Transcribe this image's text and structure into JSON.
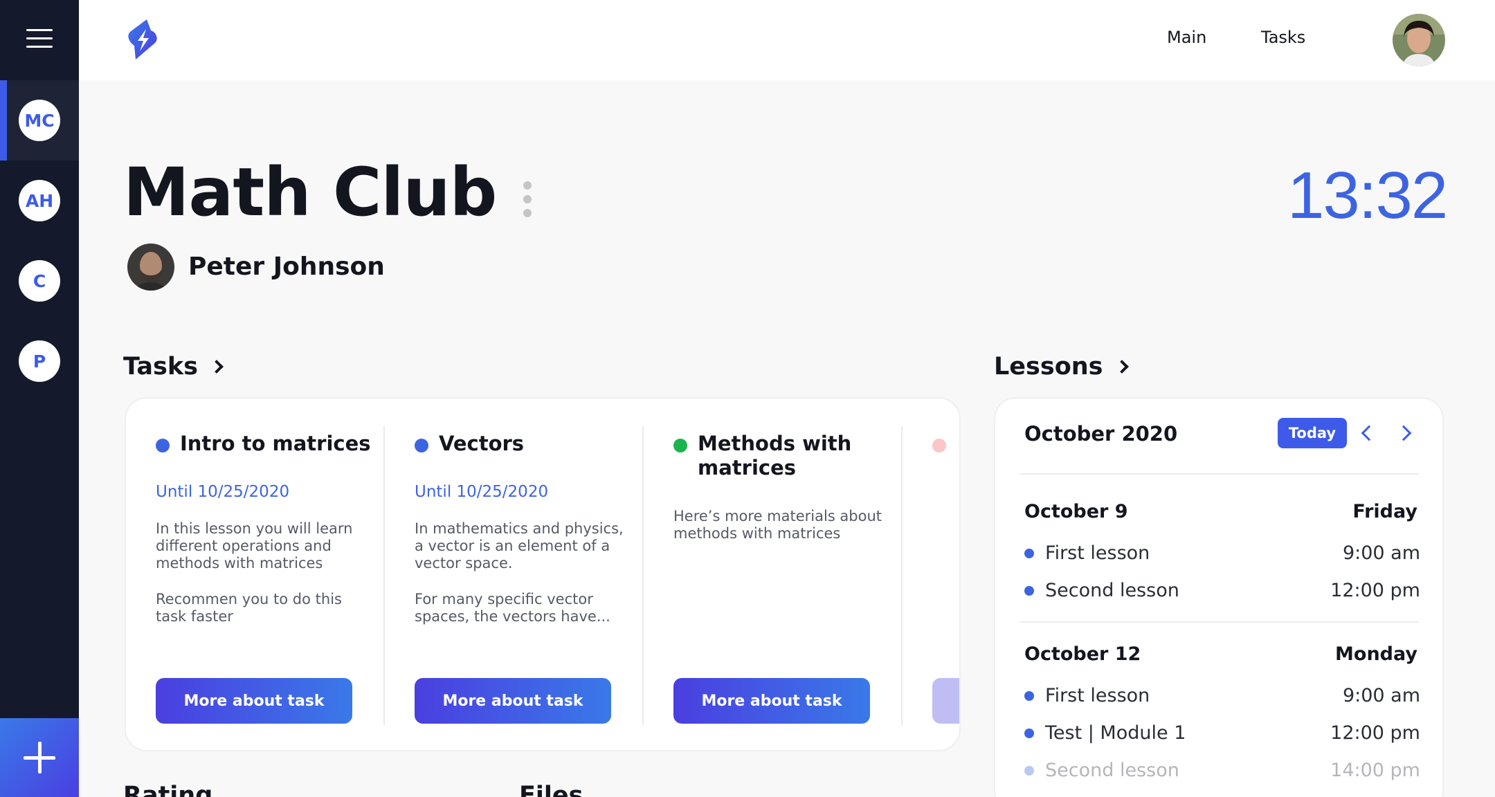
{
  "topbar": {
    "logo_icon": "lightning-bolt-icon",
    "nav": {
      "main": "Main",
      "tasks": "Tasks"
    }
  },
  "sidebar": {
    "clubs": [
      {
        "initials": "MC",
        "active": true
      },
      {
        "initials": "AH",
        "active": false
      },
      {
        "initials": "C",
        "active": false
      },
      {
        "initials": "P",
        "active": false
      }
    ]
  },
  "header": {
    "title": "Math Club",
    "teacher": "Peter Johnson",
    "time": "13:32"
  },
  "tasks": {
    "title": "Tasks",
    "button_label": "More about task",
    "items": [
      {
        "title": "Intro to matrices",
        "due": "Until 10/25/2020",
        "desc1": "In this lesson you will learn different operations and methods with matrices",
        "desc2": "Recommen you to do this task faster",
        "color": "#3d64e0"
      },
      {
        "title": "Vectors",
        "due": "Until 10/25/2020",
        "desc1": "In mathematics and physics, a vector is an element of a vector space.",
        "desc2": "For many specific vector spaces, the vectors have...",
        "color": "#3d64e0"
      },
      {
        "title": "Methods with matrices",
        "desc1": "Here’s more materials about methods with matrices",
        "color": "#1cb34e"
      }
    ]
  },
  "lessons": {
    "title": "Lessons",
    "month": "October 2020",
    "today_label": "Today",
    "days": [
      {
        "date": "October 9",
        "weekday": "Friday",
        "items": [
          {
            "name": "First lesson",
            "time": "9:00 am"
          },
          {
            "name": "Second lesson",
            "time": "12:00 pm"
          }
        ]
      },
      {
        "date": "October 12",
        "weekday": "Monday",
        "items": [
          {
            "name": "First lesson",
            "time": "9:00 am"
          },
          {
            "name": "Test | Module 1",
            "time": "12:00 pm"
          },
          {
            "name": "Second lesson",
            "time": "14:00 pm"
          }
        ]
      }
    ]
  },
  "bottom": {
    "rating": "Rating",
    "files": "Files"
  },
  "colors": {
    "sidebar": "#141a2b",
    "accent": "#3d5be8",
    "clock": "#3d64e0"
  }
}
